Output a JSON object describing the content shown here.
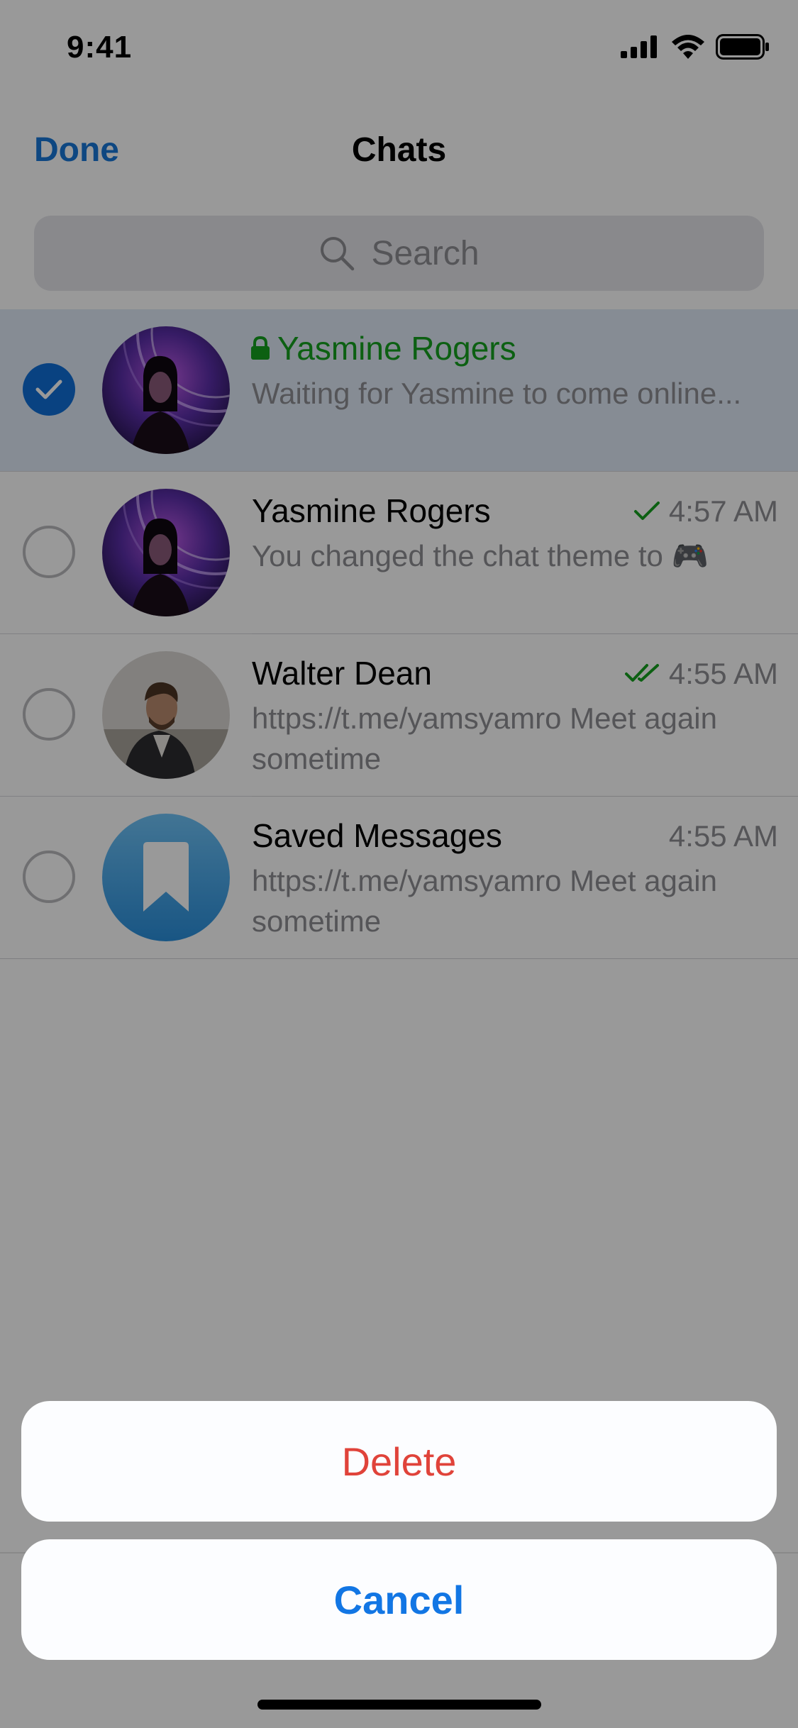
{
  "status_bar": {
    "time": "9:41"
  },
  "nav": {
    "done_label": "Done",
    "title": "Chats"
  },
  "search": {
    "placeholder": "Search"
  },
  "chats": [
    {
      "name": "Yasmine Rogers",
      "preview": "Waiting for Yasmine to come online...",
      "time": "",
      "selected": true,
      "secret": true
    },
    {
      "name": "Yasmine Rogers",
      "preview": "You changed the chat theme to 🎮",
      "time": "4:57 AM",
      "selected": false,
      "status": "sent"
    },
    {
      "name": "Walter Dean",
      "preview": "https://t.me/yamsyamro Meet again sometime",
      "time": "4:55 AM",
      "selected": false,
      "status": "read"
    },
    {
      "name": "Saved Messages",
      "preview": "https://t.me/yamsyamro Meet again sometime",
      "time": "4:55 AM",
      "selected": false
    }
  ],
  "action_sheet": {
    "delete_label": "Delete",
    "cancel_label": "Cancel"
  },
  "colors": {
    "accent": "#1877d8",
    "secret": "#15a01f",
    "destructive": "#e0433a"
  }
}
